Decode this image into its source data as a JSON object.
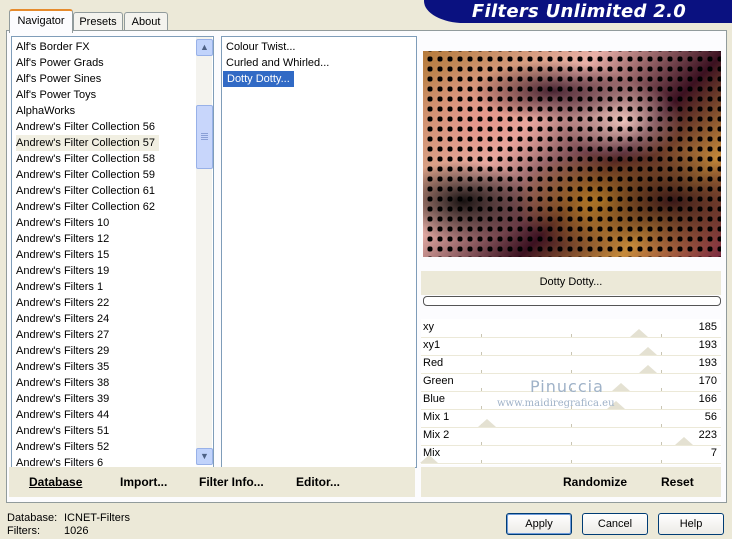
{
  "header": {
    "title": "Filters Unlimited 2.0"
  },
  "tabs": [
    {
      "label": "Navigator",
      "active": true
    },
    {
      "label": "Presets",
      "active": false
    },
    {
      "label": "About",
      "active": false
    }
  ],
  "categories": [
    "Alf's Border FX",
    "Alf's Power Grads",
    "Alf's Power Sines",
    "Alf's Power Toys",
    "AlphaWorks",
    "Andrew's Filter Collection 56",
    "Andrew's Filter Collection 57",
    "Andrew's Filter Collection 58",
    "Andrew's Filter Collection 59",
    "Andrew's Filter Collection 61",
    "Andrew's Filter Collection 62",
    "Andrew's Filters 10",
    "Andrew's Filters 12",
    "Andrew's Filters 15",
    "Andrew's Filters 19",
    "Andrew's Filters 1",
    "Andrew's Filters 22",
    "Andrew's Filters 24",
    "Andrew's Filters 27",
    "Andrew's Filters 29",
    "Andrew's Filters 35",
    "Andrew's Filters 38",
    "Andrew's Filters 39",
    "Andrew's Filters 44",
    "Andrew's Filters 51",
    "Andrew's Filters 52",
    "Andrew's Filters 6"
  ],
  "selected_category": "Andrew's Filter Collection 57",
  "filters": [
    "Colour Twist...",
    "Curled and Whirled...",
    "Dotty Dotty..."
  ],
  "selected_filter": "Dotty Dotty...",
  "toolbar": {
    "database": "Database",
    "import": "Import...",
    "filter_info": "Filter Info...",
    "editor": "Editor...",
    "randomize": "Randomize",
    "reset": "Reset"
  },
  "preview": {
    "filter_name": "Dotty Dotty..."
  },
  "sliders": [
    {
      "label": "xy",
      "value": "185",
      "fraction": 0.725
    },
    {
      "label": "xy1",
      "value": "193",
      "fraction": 0.757
    },
    {
      "label": "Red",
      "value": "193",
      "fraction": 0.757
    },
    {
      "label": "Green",
      "value": "170",
      "fraction": 0.667
    },
    {
      "label": "Blue",
      "value": "166",
      "fraction": 0.651
    },
    {
      "label": "Mix 1",
      "value": "56",
      "fraction": 0.22
    },
    {
      "label": "Mix 2",
      "value": "223",
      "fraction": 0.875
    },
    {
      "label": "Mix",
      "value": "7",
      "fraction": 0.027
    }
  ],
  "watermark": {
    "name": "Pinuccia",
    "site": "www.maidiregrafica.eu"
  },
  "footer": {
    "database_label": "Database:",
    "database_value": "ICNET-Filters",
    "filters_label": "Filters:",
    "filters_value": "1026",
    "apply": "Apply",
    "cancel": "Cancel",
    "help": "Help"
  }
}
